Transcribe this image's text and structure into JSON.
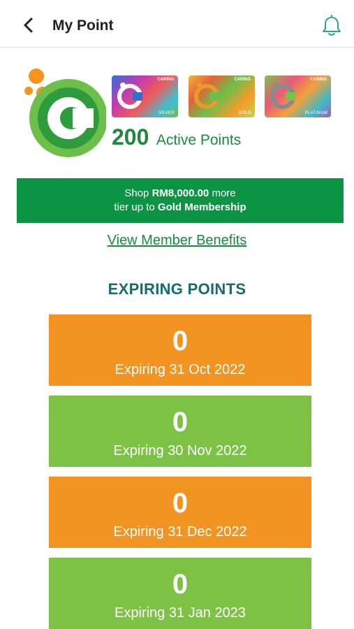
{
  "header": {
    "title": "My Point",
    "back_icon": "chevron-left-icon",
    "notification_icon": "bell-icon"
  },
  "cards": [
    {
      "tier": "SILVER",
      "brand": "CARING"
    },
    {
      "tier": "GOLD",
      "brand": "CARING"
    },
    {
      "tier": "PLATINUM",
      "brand": "CARING"
    }
  ],
  "points": {
    "value": "200",
    "label": "Active Points"
  },
  "banner": {
    "line1_prefix": "Shop",
    "amount": "RM8,000.00",
    "line1_suffix": "more",
    "line2_prefix": "tier up to",
    "tier_name": "Gold Membership"
  },
  "benefits_link": "View Member Benefits",
  "expiring": {
    "title": "EXPIRING POINTS",
    "items": [
      {
        "value": "0",
        "label": "Expiring 31 Oct 2022"
      },
      {
        "value": "0",
        "label": "Expiring 30 Nov 2022"
      },
      {
        "value": "0",
        "label": "Expiring 31 Dec 2022"
      },
      {
        "value": "0",
        "label": "Expiring 31 Jan 2023"
      }
    ]
  },
  "colors": {
    "brand_green": "#0a9444",
    "text_green": "#1b8a3c",
    "orange": "#f39322",
    "light_green": "#7dc244",
    "teal": "#166b6b"
  }
}
